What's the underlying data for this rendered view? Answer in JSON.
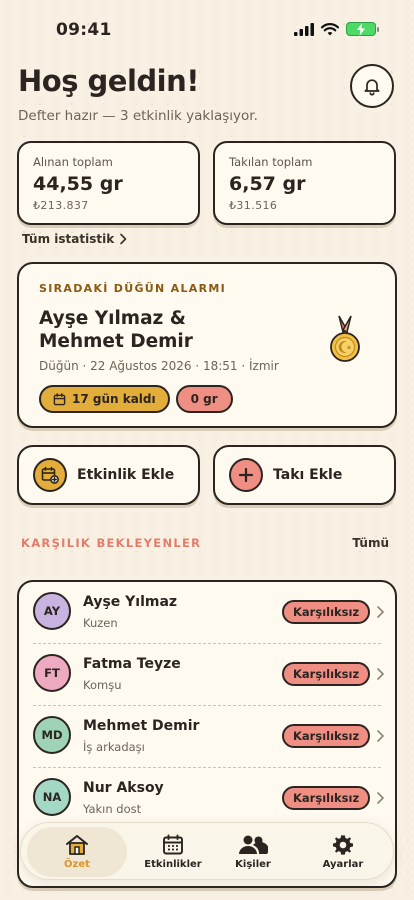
{
  "status": {
    "time": "09:41"
  },
  "header": {
    "greeting": "Hoş geldin!",
    "subtitle": "Defter hazır — 3 etkinlik yaklaşıyor."
  },
  "stats": {
    "received": {
      "label": "Alınan toplam",
      "value": "44,55 gr",
      "money": "₺213.837"
    },
    "given": {
      "label": "Takılan toplam",
      "value": "6,57 gr",
      "money": "₺31.516"
    },
    "all_link": "Tüm istatistik"
  },
  "alarm": {
    "kicker": "SIRADAKİ DÜĞÜN ALARMI",
    "title_line1": "Ayşe Yılmaz &",
    "title_line2": "Mehmet Demir",
    "meta": "Düğün · 22 Ağustos 2026 · 18:51 · İzmir",
    "days_left": "17 gün kaldı",
    "gold": "0 gr"
  },
  "actions": {
    "add_event": "Etkinlik Ekle",
    "add_jewelry": "Takı Ekle"
  },
  "pending": {
    "title": "KARŞILIK BEKLEYENLER",
    "all": "Tümü",
    "rows": [
      {
        "initials": "AY",
        "name": "Ayşe Yılmaz",
        "relation": "Kuzen",
        "status": "Karşılıksız",
        "color": "#c9b3e0"
      },
      {
        "initials": "FT",
        "name": "Fatma Teyze",
        "relation": "Komşu",
        "status": "Karşılıksız",
        "color": "#eeaac0"
      },
      {
        "initials": "MD",
        "name": "Mehmet Demir",
        "relation": "İş arkadaşı",
        "status": "Karşılıksız",
        "color": "#9fd3b5"
      },
      {
        "initials": "NA",
        "name": "Nur Aksoy",
        "relation": "Yakın dost",
        "status": "Karşılıksız",
        "color": "#a3d9c4"
      }
    ]
  },
  "tabs": [
    {
      "label": "Özet",
      "icon": "home-icon",
      "active": true
    },
    {
      "label": "Etkinlikler",
      "icon": "calendar-icon",
      "active": false
    },
    {
      "label": "Kişiler",
      "icon": "people-icon",
      "active": false
    },
    {
      "label": "Ayarlar",
      "icon": "gear-icon",
      "active": false
    }
  ],
  "colors": {
    "background": "#f8f1e3",
    "ink": "#2b2420",
    "gold": "#e3ad3b",
    "coral": "#ef8f83",
    "section_accent": "#e47c6c"
  }
}
